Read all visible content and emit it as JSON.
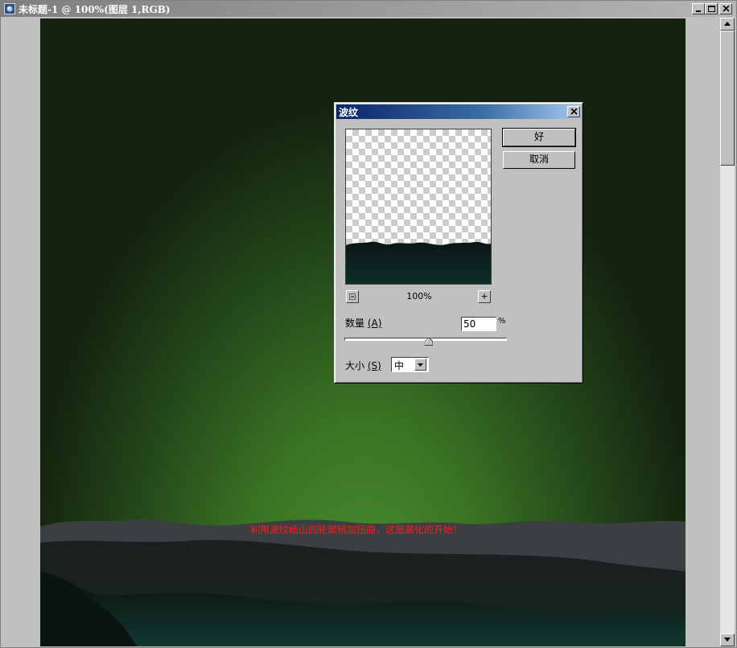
{
  "window": {
    "title": "未标题-1 @ 100%(图层 1,RGB)",
    "buttons": {
      "minimize": "minimize-icon",
      "maximize": "maximize-icon",
      "close": "close-icon"
    }
  },
  "canvas": {
    "annotation": "利用波纹给山的轮廓稍加扭曲，这是离化的开始！",
    "colors": {
      "sky_center": "#4a8c2e",
      "sky_edge": "#14220f",
      "mountain_far": "#3a3f41",
      "mountain_near": "#0f1b1a",
      "annotation": "#ff1a1a"
    }
  },
  "dialog": {
    "title": "波纹",
    "ok_label": "好",
    "cancel_label": "取消",
    "zoom_out_label": "−",
    "zoom_in_label": "+",
    "zoom_level": "100%",
    "amount_label": "数量",
    "amount_mnemonic": "(A)",
    "amount_value": "50",
    "amount_unit": "%",
    "amount_slider_fraction": 0.52,
    "size_label": "大小",
    "size_mnemonic": "(S)",
    "size_value": "中",
    "title_color": "#0a246a"
  }
}
